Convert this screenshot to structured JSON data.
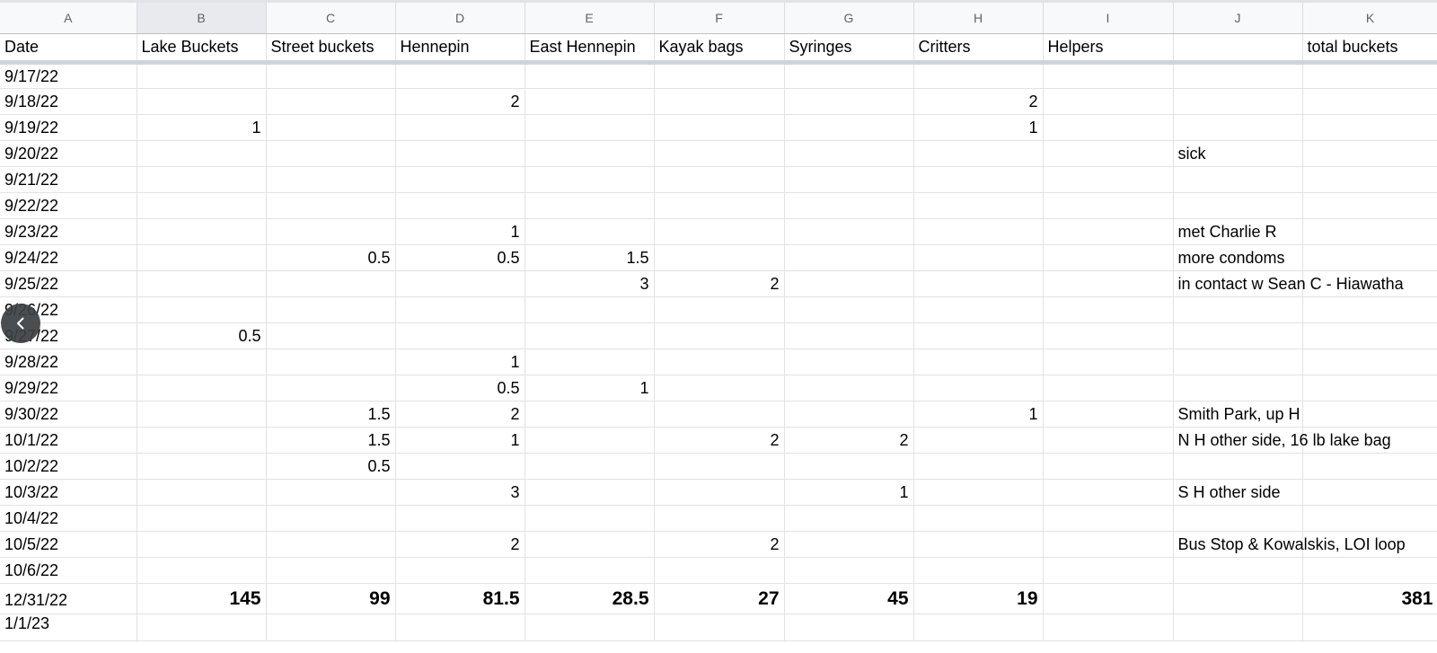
{
  "columns": [
    "A",
    "B",
    "C",
    "D",
    "E",
    "F",
    "G",
    "H",
    "I",
    "J",
    "K"
  ],
  "header": [
    "Date",
    "Lake Buckets",
    "Street buckets",
    "Hennepin",
    "East Hennepin",
    "Kayak bags",
    "Syringes",
    "Critters",
    "Helpers",
    "",
    "total buckets"
  ],
  "rows": [
    [
      "9/17/22",
      "",
      "",
      "",
      "",
      "",
      "",
      "",
      "",
      "",
      ""
    ],
    [
      "9/18/22",
      "",
      "",
      "2",
      "",
      "",
      "",
      "2",
      "",
      "",
      ""
    ],
    [
      "9/19/22",
      "1",
      "",
      "",
      "",
      "",
      "",
      "1",
      "",
      "",
      ""
    ],
    [
      "9/20/22",
      "",
      "",
      "",
      "",
      "",
      "",
      "",
      "",
      "sick",
      ""
    ],
    [
      "9/21/22",
      "",
      "",
      "",
      "",
      "",
      "",
      "",
      "",
      "",
      ""
    ],
    [
      "9/22/22",
      "",
      "",
      "",
      "",
      "",
      "",
      "",
      "",
      "",
      ""
    ],
    [
      "9/23/22",
      "",
      "",
      "1",
      "",
      "",
      "",
      "",
      "",
      "met Charlie R",
      ""
    ],
    [
      "9/24/22",
      "",
      "0.5",
      "0.5",
      "1.5",
      "",
      "",
      "",
      "",
      "more condoms",
      ""
    ],
    [
      "9/25/22",
      "",
      "",
      "",
      "3",
      "2",
      "",
      "",
      "",
      "in contact w Sean C - Hiawatha",
      ""
    ],
    [
      "9/26/22",
      "",
      "",
      "",
      "",
      "",
      "",
      "",
      "",
      "",
      ""
    ],
    [
      "9/27/22",
      "0.5",
      "",
      "",
      "",
      "",
      "",
      "",
      "",
      "",
      ""
    ],
    [
      "9/28/22",
      "",
      "",
      "1",
      "",
      "",
      "",
      "",
      "",
      "",
      ""
    ],
    [
      "9/29/22",
      "",
      "",
      "0.5",
      "1",
      "",
      "",
      "",
      "",
      "",
      ""
    ],
    [
      "9/30/22",
      "",
      "1.5",
      "2",
      "",
      "",
      "",
      "1",
      "",
      "Smith Park, up H",
      ""
    ],
    [
      "10/1/22",
      "",
      "1.5",
      "1",
      "",
      "2",
      "2",
      "",
      "",
      "N H other side, 16 lb lake bag",
      ""
    ],
    [
      "10/2/22",
      "",
      "0.5",
      "",
      "",
      "",
      "",
      "",
      "",
      "",
      ""
    ],
    [
      "10/3/22",
      "",
      "",
      "3",
      "",
      "",
      "1",
      "",
      "",
      "S H other side",
      ""
    ],
    [
      "10/4/22",
      "",
      "",
      "",
      "",
      "",
      "",
      "",
      "",
      "",
      ""
    ],
    [
      "10/5/22",
      "",
      "",
      "2",
      "",
      "2",
      "",
      "",
      "",
      "Bus Stop & Kowalskis, LOI loop",
      ""
    ],
    [
      "10/6/22",
      "",
      "",
      "",
      "",
      "",
      "",
      "",
      "",
      "",
      ""
    ]
  ],
  "total_row": [
    "12/31/22",
    "145",
    "99",
    "81.5",
    "28.5",
    "27",
    "45",
    "19",
    "",
    "",
    "381"
  ],
  "last_row": [
    "1/1/23",
    "",
    "",
    "",
    "",
    "",
    "",
    "",
    "",
    "",
    ""
  ],
  "selected_column": "B",
  "collapse_button": {
    "icon": "chevron-left-icon"
  }
}
